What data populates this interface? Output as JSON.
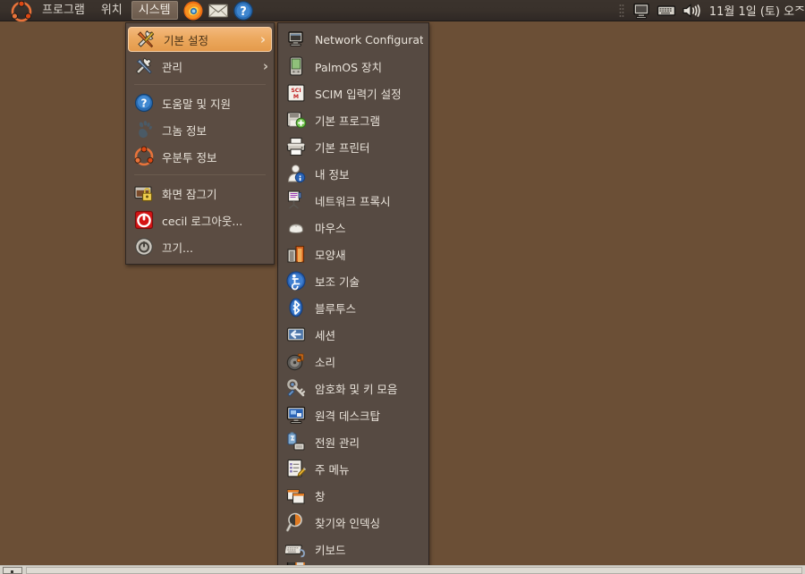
{
  "desktop": {
    "background_color": "#6b4f36"
  },
  "top_panel": {
    "background_color": "#39312b",
    "logo_icon": "ubuntu-logo-icon",
    "menus": [
      {
        "label": "프로그램",
        "active": false,
        "name": "applications"
      },
      {
        "label": "위치",
        "active": false,
        "name": "places"
      },
      {
        "label": "시스템",
        "active": true,
        "name": "system"
      }
    ],
    "launchers": [
      {
        "name": "firefox-icon",
        "title": "Firefox"
      },
      {
        "name": "mail-icon",
        "title": "Evolution Mail"
      },
      {
        "name": "help-icon",
        "title": "Help"
      }
    ],
    "tray": [
      {
        "name": "display-icon"
      },
      {
        "name": "keyboard-tray-icon"
      },
      {
        "name": "volume-icon"
      }
    ],
    "clock": "11월  1일 (토) 오ᄌ"
  },
  "bottom_panel": {
    "background_color": "#d6d3cb",
    "show_desktop_label": "show-desktop-button",
    "window_list_label": "window-list"
  },
  "system_menu": {
    "highlight_color": "#eca95f",
    "background_color": "#5b4c42",
    "items": [
      {
        "label": "기본 설정",
        "icon": "preferences-icon",
        "submenu": true,
        "highlight": true,
        "name": "menu-item-preferences"
      },
      {
        "label": "관리",
        "icon": "administration-icon",
        "submenu": true,
        "highlight": false,
        "name": "menu-item-administration"
      },
      {
        "separator": true
      },
      {
        "label": "도움말 및 지원",
        "icon": "help-circle-icon",
        "submenu": false,
        "highlight": false,
        "name": "menu-item-help-support"
      },
      {
        "label": "그놈 정보",
        "icon": "gnome-foot-icon",
        "submenu": false,
        "highlight": false,
        "name": "menu-item-about-gnome"
      },
      {
        "label": "우분투 정보",
        "icon": "ubuntu-logo-icon",
        "submenu": false,
        "highlight": false,
        "name": "menu-item-about-ubuntu"
      },
      {
        "separator": true
      },
      {
        "label": "화면 잠그기",
        "icon": "lock-screen-icon",
        "submenu": false,
        "highlight": false,
        "name": "menu-item-lock-screen"
      },
      {
        "label": "cecil 로그아웃...",
        "icon": "logout-icon",
        "submenu": false,
        "highlight": false,
        "name": "menu-item-logout"
      },
      {
        "label": "끄기...",
        "icon": "shutdown-icon",
        "submenu": false,
        "highlight": false,
        "name": "menu-item-shutdown"
      }
    ]
  },
  "preferences_submenu": {
    "background_color": "#564a42",
    "items": [
      {
        "label": "Network Configuration",
        "icon": "network-config-icon",
        "name": "submenu-item-network-configuration"
      },
      {
        "label": "PalmOS 장치",
        "icon": "palmos-icon",
        "name": "submenu-item-palmos-devices"
      },
      {
        "label": "SCIM 입력기 설정",
        "icon": "scim-icon",
        "name": "submenu-item-scim-input-method"
      },
      {
        "label": "기본 프로그램",
        "icon": "default-apps-icon",
        "name": "submenu-item-preferred-applications"
      },
      {
        "label": "기본 프린터",
        "icon": "printer-icon",
        "name": "submenu-item-default-printer"
      },
      {
        "label": "내 정보",
        "icon": "about-me-icon",
        "name": "submenu-item-about-me"
      },
      {
        "label": "네트워크 프록시",
        "icon": "network-proxy-icon",
        "name": "submenu-item-network-proxy"
      },
      {
        "label": "마우스",
        "icon": "mouse-icon",
        "name": "submenu-item-mouse"
      },
      {
        "label": "모양새",
        "icon": "appearance-icon",
        "name": "submenu-item-appearance"
      },
      {
        "label": "보조 기술",
        "icon": "accessibility-icon",
        "name": "submenu-item-assistive-technology"
      },
      {
        "label": "블루투스",
        "icon": "bluetooth-icon",
        "name": "submenu-item-bluetooth"
      },
      {
        "label": "세션",
        "icon": "session-icon",
        "name": "submenu-item-sessions"
      },
      {
        "label": "소리",
        "icon": "sound-icon",
        "name": "submenu-item-sound"
      },
      {
        "label": "암호화 및 키 모음",
        "icon": "encryption-keyring-icon",
        "name": "submenu-item-encryption-keyrings"
      },
      {
        "label": "원격 데스크탑",
        "icon": "remote-desktop-icon",
        "name": "submenu-item-remote-desktop"
      },
      {
        "label": "전원 관리",
        "icon": "power-management-icon",
        "name": "submenu-item-power-management"
      },
      {
        "label": "주 메뉴",
        "icon": "main-menu-icon",
        "name": "submenu-item-main-menu"
      },
      {
        "label": "창",
        "icon": "windows-icon",
        "name": "submenu-item-windows"
      },
      {
        "label": "찾기와 인덱싱",
        "icon": "search-indexing-icon",
        "name": "submenu-item-search-and-indexing"
      },
      {
        "label": "키보드",
        "icon": "keyboard-icon",
        "name": "submenu-item-keyboard"
      },
      {
        "label": "",
        "icon": "clipped-icon",
        "name": "submenu-item-clipped"
      }
    ]
  }
}
